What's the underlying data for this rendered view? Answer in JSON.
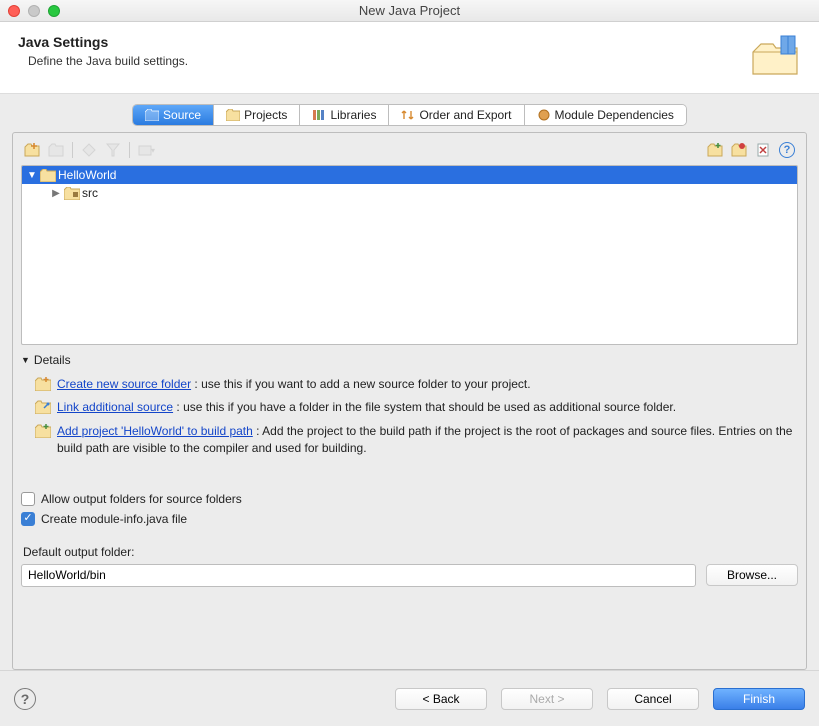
{
  "window": {
    "title": "New Java Project"
  },
  "header": {
    "title": "Java Settings",
    "subtitle": "Define the Java build settings."
  },
  "tabs": {
    "source": "Source",
    "projects": "Projects",
    "libraries": "Libraries",
    "order": "Order and Export",
    "modules": "Module Dependencies"
  },
  "tree": {
    "root": "HelloWorld",
    "child": "src"
  },
  "details": {
    "header": "Details",
    "item1_link": "Create new source folder",
    "item1_rest": " : use this if you want to add a new source folder to your project.",
    "item2_link": "Link additional source",
    "item2_rest": " : use this if you have a folder in the file system that should be used as additional source folder.",
    "item3_link": "Add project 'HelloWorld' to build path",
    "item3_rest": " : Add the project to the build path if the project is the root of packages and source files. Entries on the build path are visible to the compiler and used for building."
  },
  "options": {
    "allow_output": "Allow output folders for source folders",
    "create_module": "Create module-info.java file"
  },
  "output": {
    "label": "Default output folder:",
    "value": "HelloWorld/bin",
    "browse": "Browse..."
  },
  "footer": {
    "back": "< Back",
    "next": "Next >",
    "cancel": "Cancel",
    "finish": "Finish"
  }
}
